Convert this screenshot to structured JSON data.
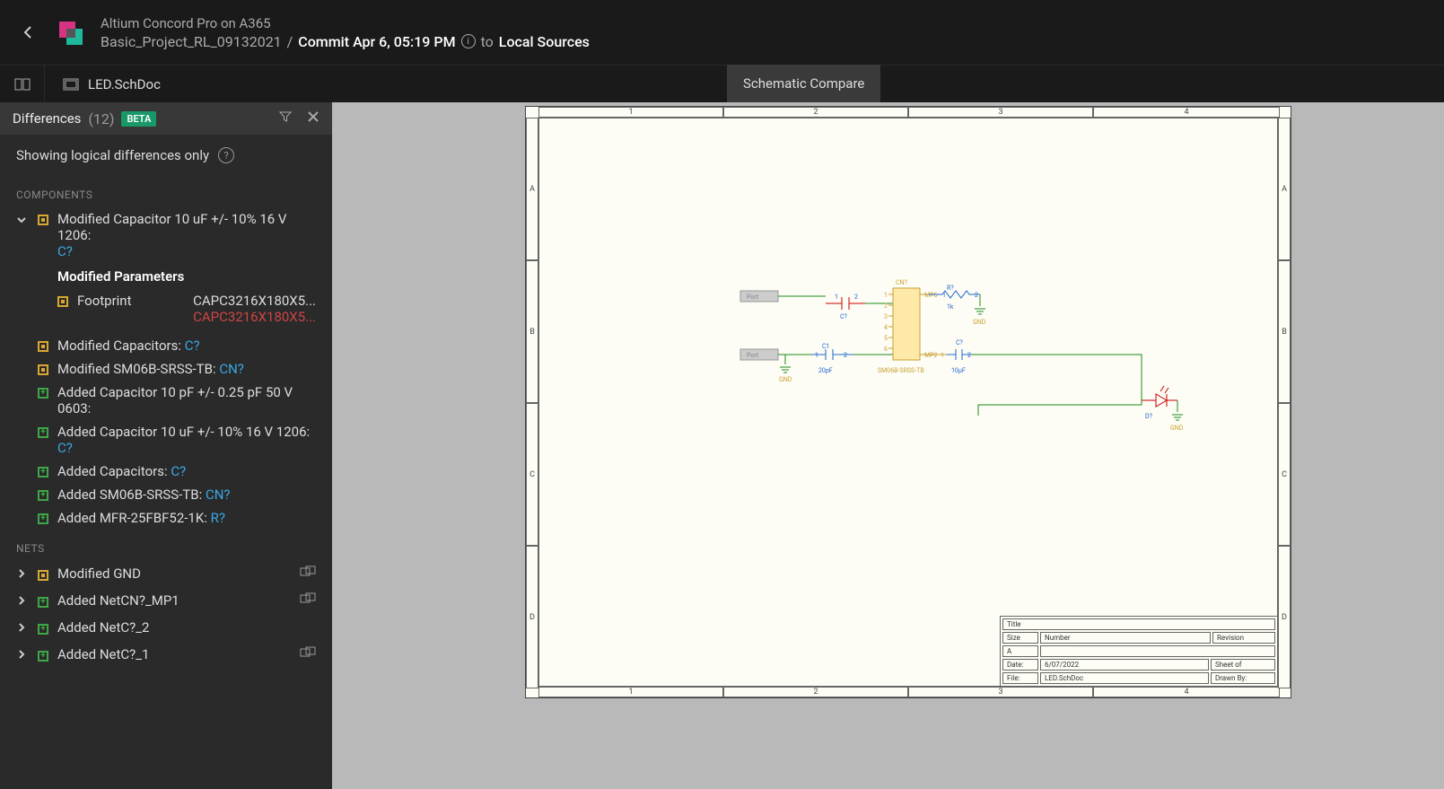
{
  "header": {
    "title": "Altium Concord Pro on A365",
    "bc_project": "Basic_Project_RL_09132021",
    "bc_sep": "/",
    "bc_commit": "Commit Apr 6, 05:19 PM",
    "bc_to": "to",
    "bc_local": "Local Sources"
  },
  "file_tab": "LED.SchDoc",
  "compare_tab": "Schematic Compare",
  "diff": {
    "title": "Differences",
    "count": "(12)",
    "beta": "BETA",
    "sub": "Showing logical differences only"
  },
  "sections": {
    "components": "COMPONENTS",
    "nets": "NETS"
  },
  "comp_expanded": {
    "title": "Modified Capacitor 10 uF +/- 10% 16 V 1206:",
    "ref": "C?",
    "mod_params": "Modified Parameters",
    "fp_label": "Footprint",
    "fp_new": "CAPC3216X180X5...",
    "fp_old": "CAPC3216X180X5..."
  },
  "comp_rows": [
    {
      "kind": "mod",
      "text": "Modified Capacitors: ",
      "link": "C?"
    },
    {
      "kind": "mod",
      "text": "Modified SM06B-SRSS-TB: ",
      "link": "CN?"
    },
    {
      "kind": "add",
      "text": "Added Capacitor 10 pF +/- 0.25 pF 50 V 0603:",
      "link": ""
    },
    {
      "kind": "add",
      "text": "Added Capacitor 10 uF +/- 10% 16 V 1206: ",
      "link": "C?"
    },
    {
      "kind": "add",
      "text": "Added Capacitors: ",
      "link": "C?"
    },
    {
      "kind": "add",
      "text": "Added SM06B-SRSS-TB: ",
      "link": "CN?"
    },
    {
      "kind": "add",
      "text": "Added MFR-25FBF52-1K: ",
      "link": "R?"
    }
  ],
  "net_rows": [
    {
      "kind": "mod",
      "text": "Modified GND",
      "icon": true
    },
    {
      "kind": "add",
      "text": "Added NetCN?_MP1",
      "icon": true
    },
    {
      "kind": "add",
      "text": "Added NetC?_2",
      "icon": false
    },
    {
      "kind": "add",
      "text": "Added NetC?_1",
      "icon": true
    }
  ],
  "ruler": {
    "c1": "1",
    "c2": "2",
    "c3": "3",
    "c4": "4",
    "rA": "A",
    "rB": "B",
    "rC": "C",
    "rD": "D"
  },
  "titleblock": {
    "title": "Title",
    "size": "Size",
    "number": "Number",
    "revision": "Revision",
    "sizeA": "A",
    "date": "Date:",
    "dateval": "6/07/2022",
    "sheet": "Sheet  of",
    "file": "File:",
    "fileval": "LED.SchDoc",
    "drawn": "Drawn By:"
  },
  "sch": {
    "port": "Port",
    "cn": "CN?",
    "ic": "SM06B-SRSS-TB",
    "mp6": "MP6",
    "mp2": "MP2",
    "r": "R?",
    "rk": "1k",
    "c1": "C1",
    "c1v": "20pF",
    "c2": "C?",
    "c3": "C?",
    "c3v": "10µF",
    "gnd": "GND",
    "d": "D?",
    "p1": "1",
    "p2": "2",
    "p3": "3",
    "p4": "4",
    "p5": "5",
    "p6": "6"
  }
}
